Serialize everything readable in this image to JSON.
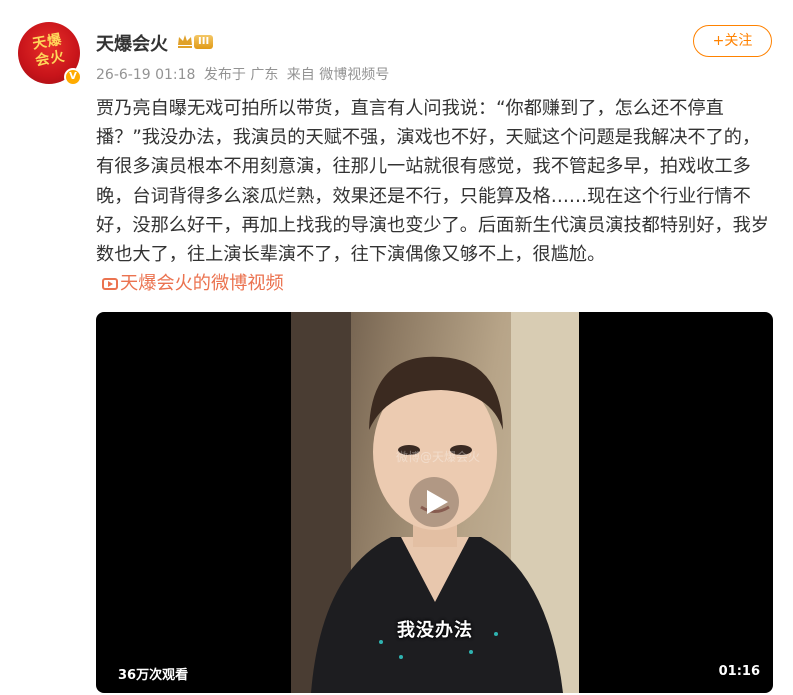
{
  "author": {
    "name": "天爆会火",
    "avatar_text_line1": "天爆",
    "avatar_text_line2": "会火",
    "verified_mark": "V",
    "level": "III",
    "crown_icon": "crown-icon"
  },
  "post": {
    "timestamp": "26-6-19 01:18",
    "location": "发布于 广东",
    "source": "来自 微博视频号",
    "text": "贾乃亮自曝无戏可拍所以带货，直言有人问我说：“你都赚到了，怎么还不停直播？”我没办法，我演员的天赋不强，演戏也不好，天赋这个问题是我解决不了的，有很多演员根本不用刻意演，往那儿一站就很有感觉，我不管起多早，拍戏收工多晚，台词背得多么滚瓜烂熟，效果还是不行，只能算及格……现在这个行业行情不好，没那么好干，再加上找我的导演也变少了。后面新生代演员演技都特别好，我岁数也大了，往上演长辈演不了，往下演偶像又够不上，很尴尬。",
    "source_link": "天爆会火的微博视频"
  },
  "follow_button": {
    "label": "+关注"
  },
  "video": {
    "view_count": "36万次观看",
    "duration": "01:16",
    "subtitle": "我没办法",
    "watermark": "微博@天爆会火"
  },
  "colors": {
    "accent": "#ff8200",
    "link": "#eb7350",
    "meta_gray": "#939393"
  }
}
